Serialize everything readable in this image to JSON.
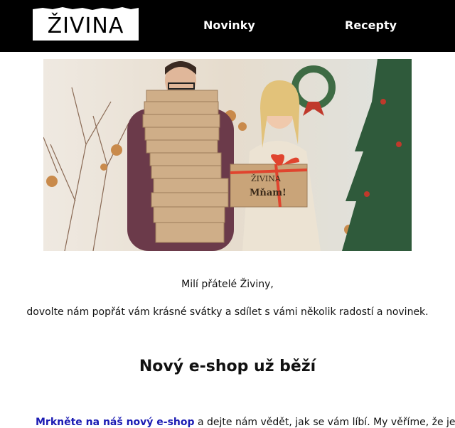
{
  "header": {
    "logo_text": "ŽIVINA",
    "nav": [
      {
        "label": "Novinky"
      },
      {
        "label": "Recepty"
      }
    ]
  },
  "hero": {
    "image": "christmas-couple-with-gift-boxes",
    "box_label_brand": "ŽIVINA",
    "box_label_text": "Mňam!"
  },
  "content": {
    "greeting": "Milí přátelé Živiny,",
    "intro": "dovolte nám popřát vám krásné svátky a sdílet s vámi několik radostí a novinek.",
    "heading": "Nový e-shop už běží",
    "paragraph_link": "Mrkněte na náš nový e-shop",
    "paragraph_rest": " a dejte nám vědět, jak se vám líbí. My věříme, že je"
  },
  "colors": {
    "header_bg": "#000000",
    "link": "#1b1bb3"
  }
}
